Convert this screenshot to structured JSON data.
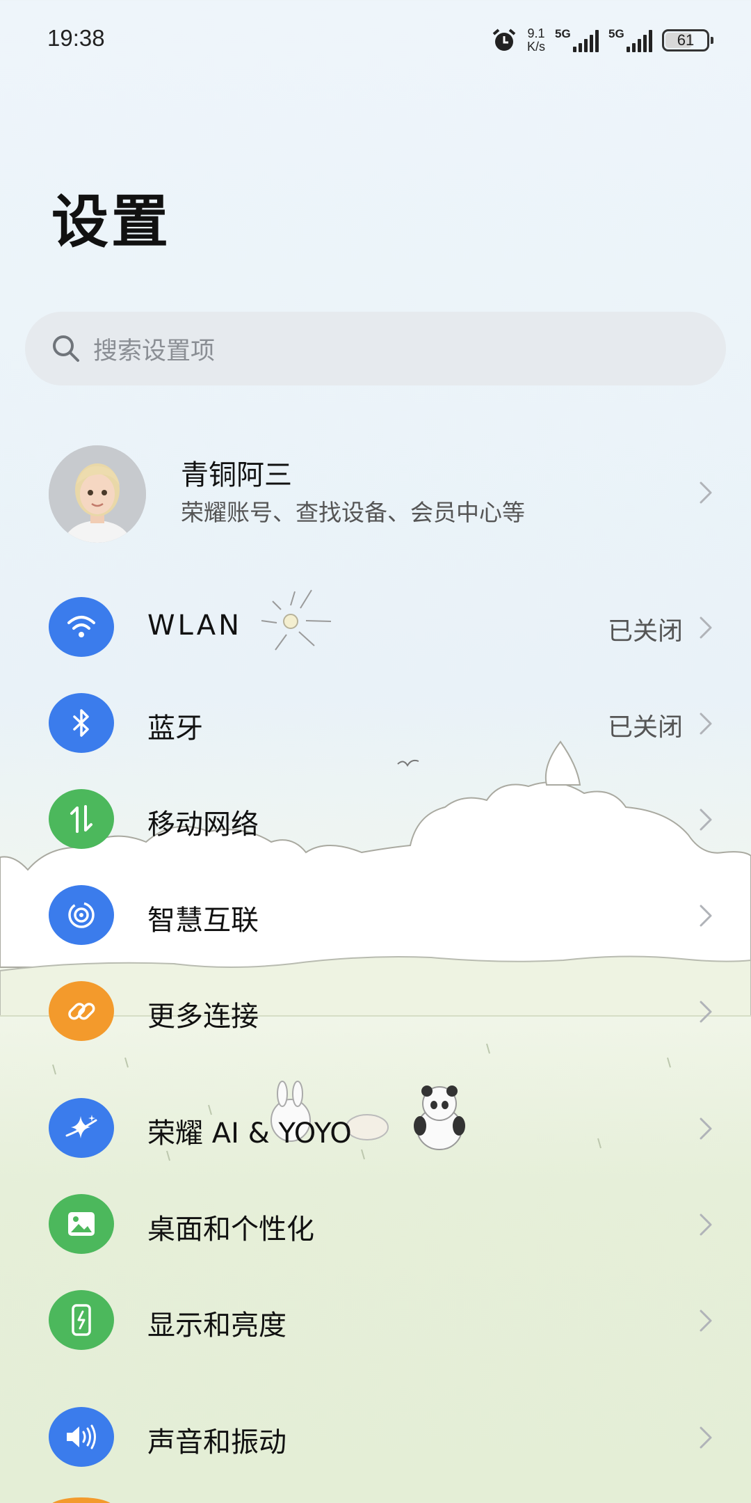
{
  "status_bar": {
    "time": "19:38",
    "speed_value": "9.1",
    "speed_unit": "K/s",
    "sim1_label": "5G",
    "sim2_label": "5G",
    "battery": "61"
  },
  "page_title": "设置",
  "search": {
    "placeholder": "搜索设置项"
  },
  "account": {
    "name": "青铜阿三",
    "subtitle": "荣耀账号、查找设备、会员中心等"
  },
  "items": [
    {
      "label": "WLAN",
      "value": "已关闭",
      "icon": "wifi-icon",
      "color": "#3b7cec"
    },
    {
      "label": "蓝牙",
      "value": "已关闭",
      "icon": "bluetooth-icon",
      "color": "#3b7cec"
    },
    {
      "label": "移动网络",
      "value": "",
      "icon": "mobile-data-icon",
      "color": "#4cb85c"
    },
    {
      "label": "智慧互联",
      "value": "",
      "icon": "smart-connect-icon",
      "color": "#3b7cec"
    },
    {
      "label": "更多连接",
      "value": "",
      "icon": "link-icon",
      "color": "#f39a2c"
    },
    {
      "label": "荣耀 AI & YOYO",
      "value": "",
      "icon": "sparkle-icon",
      "color": "#3b7cec"
    },
    {
      "label": "桌面和个性化",
      "value": "",
      "icon": "wallpaper-icon",
      "color": "#4cb85c"
    },
    {
      "label": "显示和亮度",
      "value": "",
      "icon": "display-icon",
      "color": "#4cb85c"
    },
    {
      "label": "声音和振动",
      "value": "",
      "icon": "speaker-icon",
      "color": "#3b7cec"
    }
  ]
}
